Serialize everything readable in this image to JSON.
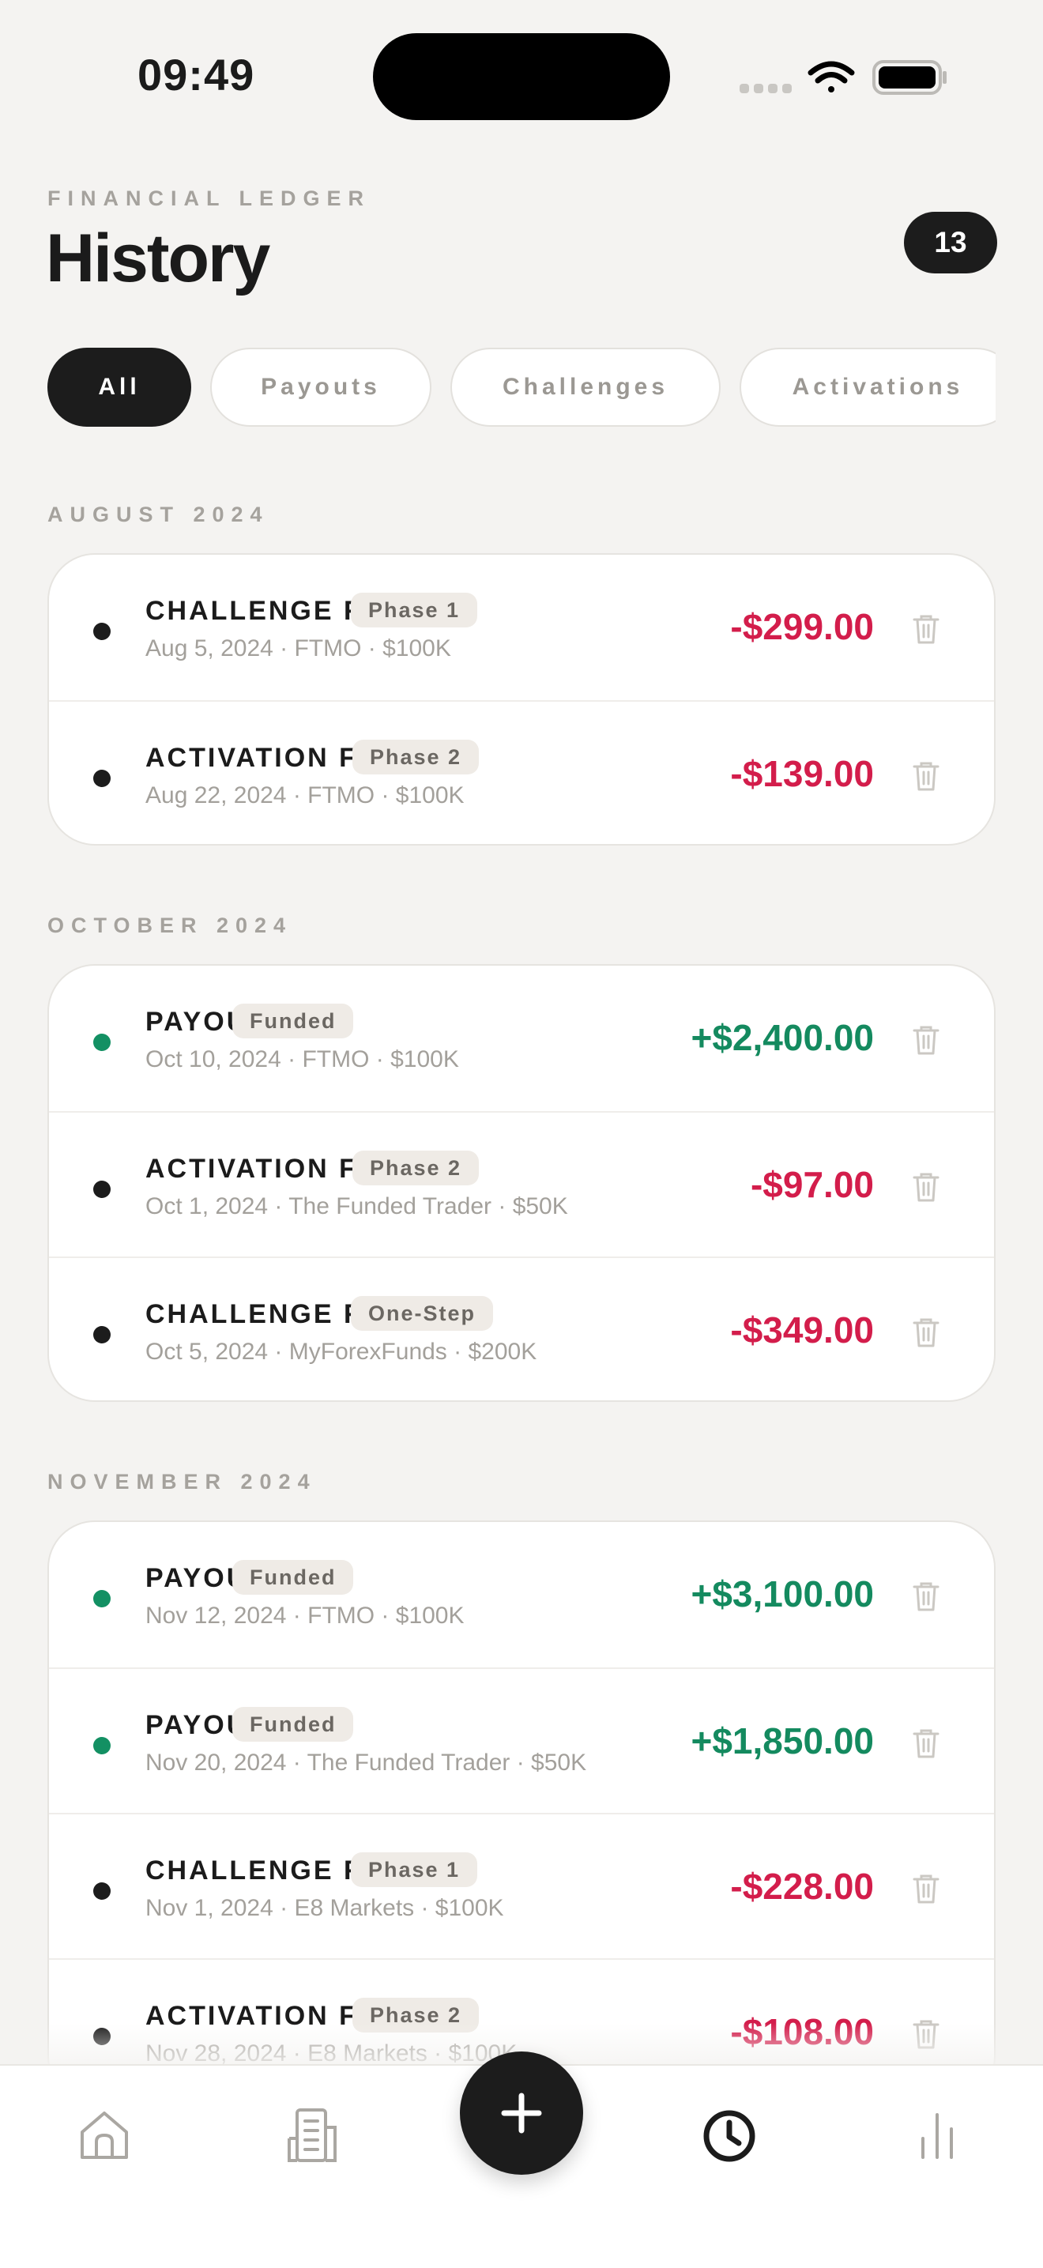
{
  "status_bar": {
    "time": "09:49"
  },
  "header": {
    "eyebrow": "FINANCIAL LEDGER",
    "title": "History",
    "count": "13"
  },
  "filters": [
    {
      "label": "All",
      "active": true
    },
    {
      "label": "Payouts",
      "active": false
    },
    {
      "label": "Challenges",
      "active": false
    },
    {
      "label": "Activations",
      "active": false
    }
  ],
  "sections": [
    {
      "label": "AUGUST 2024",
      "rows": [
        {
          "type": "CHALLENGE FEE",
          "tag": "Phase 1",
          "meta": "Aug 5, 2024 · FTMO · $100K",
          "amount": "-$299.00",
          "kind": "neg"
        },
        {
          "type": "ACTIVATION FEE",
          "tag": "Phase 2",
          "meta": "Aug 22, 2024 · FTMO · $100K",
          "amount": "-$139.00",
          "kind": "neg"
        }
      ]
    },
    {
      "label": "OCTOBER 2024",
      "rows": [
        {
          "type": "PAYOUT",
          "tag": "Funded",
          "meta": "Oct 10, 2024 · FTMO · $100K",
          "amount": "+$2,400.00",
          "kind": "pos"
        },
        {
          "type": "ACTIVATION FEE",
          "tag": "Phase 2",
          "meta": "Oct 1, 2024 · The Funded Trader · $50K",
          "amount": "-$97.00",
          "kind": "neg"
        },
        {
          "type": "CHALLENGE FEE",
          "tag": "One-Step",
          "meta": "Oct 5, 2024 · MyForexFunds · $200K",
          "amount": "-$349.00",
          "kind": "neg"
        }
      ]
    },
    {
      "label": "NOVEMBER 2024",
      "rows": [
        {
          "type": "PAYOUT",
          "tag": "Funded",
          "meta": "Nov 12, 2024 · FTMO · $100K",
          "amount": "+$3,100.00",
          "kind": "pos"
        },
        {
          "type": "PAYOUT",
          "tag": "Funded",
          "meta": "Nov 20, 2024 · The Funded Trader · $50K",
          "amount": "+$1,850.00",
          "kind": "pos"
        },
        {
          "type": "CHALLENGE FEE",
          "tag": "Phase 1",
          "meta": "Nov 1, 2024 · E8 Markets · $100K",
          "amount": "-$228.00",
          "kind": "neg"
        },
        {
          "type": "ACTIVATION FEE",
          "tag": "Phase 2",
          "meta": "Nov 28, 2024 · E8 Markets · $100K",
          "amount": "-$108.00",
          "kind": "neg"
        }
      ]
    }
  ],
  "colors": {
    "negative": "#d31d4b",
    "positive": "#148a5f",
    "accent": "#1c1c1c"
  },
  "bottom_nav": {
    "items": [
      {
        "icon": "home-icon",
        "active": false
      },
      {
        "icon": "building-icon",
        "active": false
      },
      {
        "icon": "plus-icon",
        "active": false
      },
      {
        "icon": "clock-icon",
        "active": true
      },
      {
        "icon": "bar-chart-icon",
        "active": false
      }
    ]
  }
}
